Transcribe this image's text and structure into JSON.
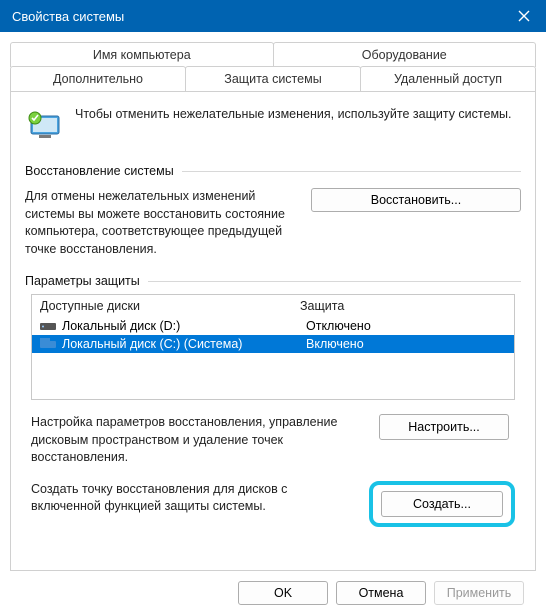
{
  "window": {
    "title": "Свойства системы"
  },
  "tabs": {
    "computer_name": "Имя компьютера",
    "hardware": "Оборудование",
    "advanced": "Дополнительно",
    "system_protection": "Защита системы",
    "remote": "Удаленный доступ"
  },
  "intro": "Чтобы отменить нежелательные изменения, используйте защиту системы.",
  "restore": {
    "section": "Восстановление системы",
    "text": "Для отмены нежелательных изменений системы вы можете восстановить состояние компьютера, соответствующее предыдущей точке восстановления.",
    "button": "Восстановить..."
  },
  "protection": {
    "section": "Параметры защиты",
    "col_drives": "Доступные диски",
    "col_protection": "Защита",
    "drives": [
      {
        "name": "Локальный диск (D:)",
        "status": "Отключено"
      },
      {
        "name": "Локальный диск (C:) (Система)",
        "status": "Включено"
      }
    ],
    "configure_text": "Настройка параметров восстановления, управление дисковым пространством и удаление точек восстановления.",
    "configure_button": "Настроить...",
    "create_text": "Создать точку восстановления для дисков с включенной функцией защиты системы.",
    "create_button": "Создать..."
  },
  "footer": {
    "ok": "OK",
    "cancel": "Отмена",
    "apply": "Применить"
  }
}
